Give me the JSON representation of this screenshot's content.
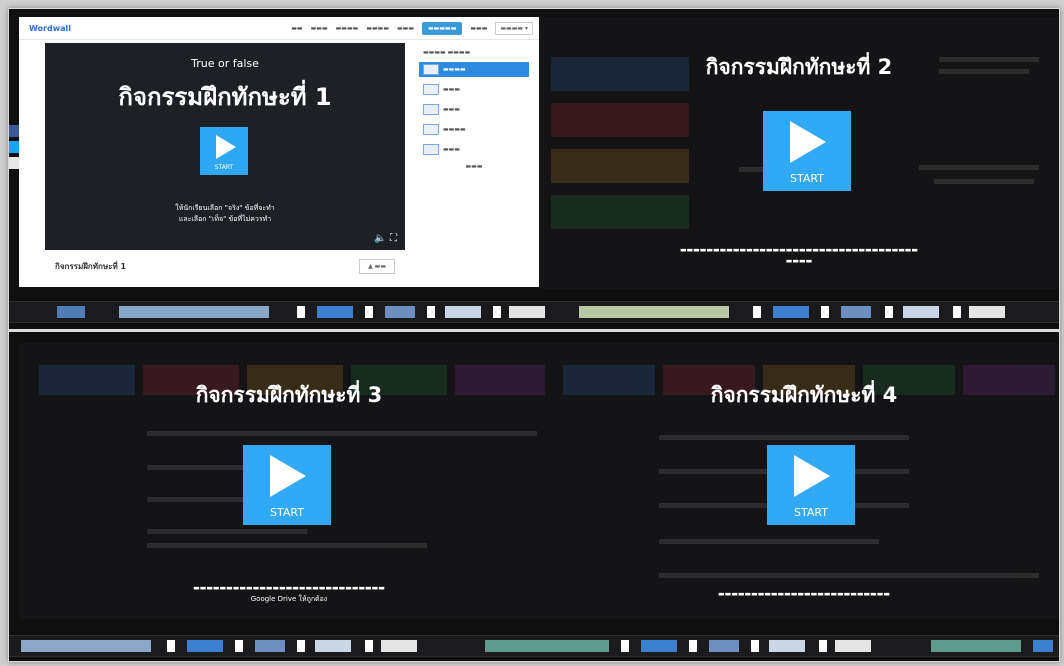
{
  "quadrant1": {
    "app_logo": "Wordwall",
    "subtitle": "True or false",
    "title": "กิจกรรมฝึกทักษะที่ 1",
    "start_label": "START",
    "instruction_line1": "ให้นักเรียนเลือก \"จริง\" ข้อที่จะทำ",
    "instruction_line2": "และเลือก \"เท็จ\" ข้อที่ไม่ควรทำ",
    "footer_name": "กิจกรรมฝึกทักษะที่ 1"
  },
  "quadrant2": {
    "title": "กิจกรรมฝึกทักษะที่ 2",
    "start_label": "START"
  },
  "quadrant3": {
    "title": "กิจกรรมฝึกทักษะที่ 3",
    "start_label": "START",
    "instruction_line2": "Google Drive ให้ถูกต้อง"
  },
  "quadrant4": {
    "title": "กิจกรรมฝึกทักษะที่ 4",
    "start_label": "START"
  },
  "colors": {
    "play_button": "#32a9f5",
    "dark_bg": "#141416",
    "accent": "#2f8be0"
  }
}
